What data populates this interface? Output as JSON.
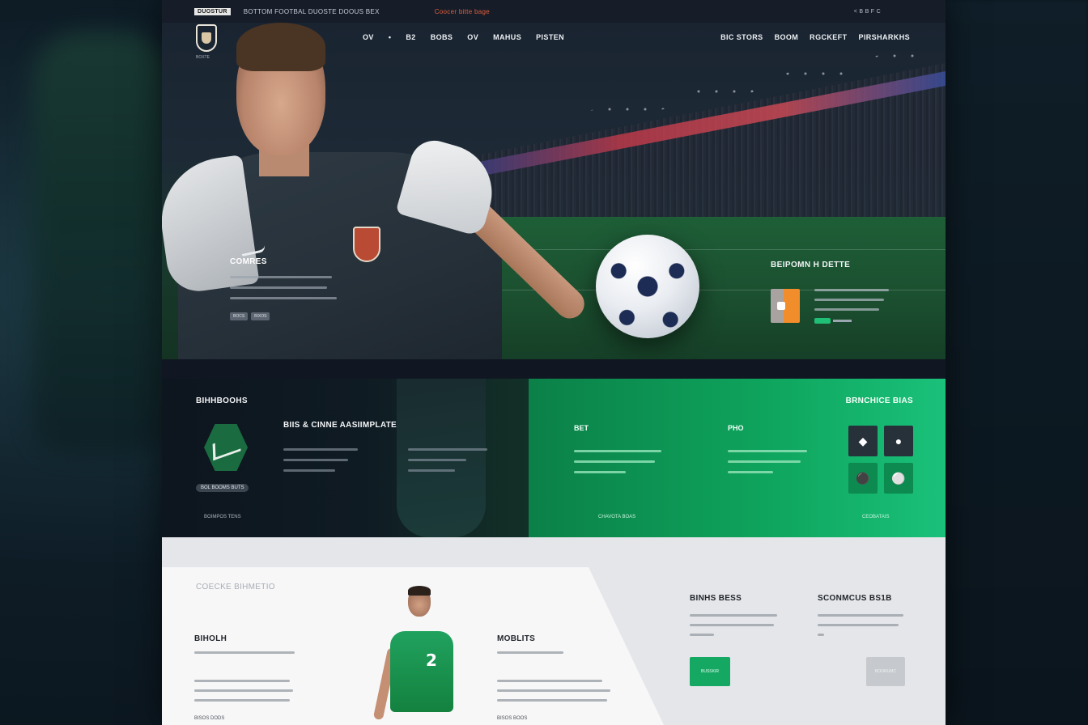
{
  "topbar": {
    "brand": "DUOSTUR",
    "text": "BOTTOM FOOTBAL DUOSTE DOOUS BEX",
    "promo": "Coocer bitte bage",
    "right": "< B B F C"
  },
  "header": {
    "logo_sub": "BOXTE",
    "nav": [
      "OV",
      "•",
      "B2",
      "BOBS",
      "OV",
      "MAHUS",
      "PISTEN"
    ],
    "nav_right": [
      "BIC STORS",
      "BOOM",
      "RGCKEFT",
      "PIRSHARKHS"
    ]
  },
  "hero": {
    "left_title": "COMRES",
    "left_buttons": [
      "BOCS",
      "BIXOS"
    ],
    "right_title": "BEIPOMN H DETTE"
  },
  "mid_dark": {
    "title": "BIHHBOOHS",
    "pill": "BOL BOOMS BUTS",
    "foot": "BOIMPOS TENS",
    "center_title": "BIIS & CINNE AASIIMPLATE"
  },
  "mid_green": {
    "title": "BRNCHICE BIAS",
    "col1_title": "BET",
    "col2_title": "PHO",
    "foot_left": "CHAVOTA BOAS",
    "foot_right": "CEOBATAIS"
  },
  "light": {
    "section_label": "COECKE BIHMETIO",
    "block1_title": "BIHOLH",
    "block1_foot": "BISOS DODS",
    "block2_title": "MOBLITS",
    "block2_foot": "BISOS BOOS",
    "block3_title": "BINHS BESS",
    "block4_title": "SCONMCUS BS1B",
    "btn_green": "BUSSKIR",
    "btn_grey": "BOORUMC",
    "player_number": "2"
  },
  "colors": {
    "accent_green": "#14a863",
    "promo_orange": "#e2603b",
    "dark_bg": "#101722"
  }
}
